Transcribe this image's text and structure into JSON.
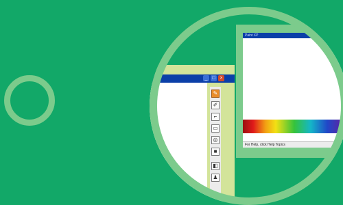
{
  "colors": {
    "background": "#12a868",
    "ring": "#7ccb8c",
    "titlebar": "#0b3fa8",
    "window_frame_left": "#d3e49a",
    "active_tool": "#e98c2a"
  },
  "left_window": {
    "tools": [
      {
        "icon": "pencil-icon",
        "glyph": "✎",
        "active": true
      },
      {
        "icon": "brush-icon",
        "glyph": "✐",
        "active": false
      },
      {
        "icon": "line-icon",
        "glyph": "⌐",
        "active": false
      },
      {
        "icon": "rectangle-icon",
        "glyph": "▭",
        "active": false
      },
      {
        "icon": "ellipse-icon",
        "glyph": "◎",
        "active": false
      },
      {
        "icon": "fill-icon",
        "glyph": "■",
        "active": false
      },
      {
        "icon": "bucket-icon",
        "glyph": "◧",
        "active": false
      },
      {
        "icon": "stamp-icon",
        "glyph": "♟",
        "active": false
      }
    ],
    "controls": {
      "minimize": "_",
      "maximize": "□",
      "close": "×"
    }
  },
  "right_window": {
    "title": "Paint XP",
    "status": "For Help, click Help Topics"
  }
}
